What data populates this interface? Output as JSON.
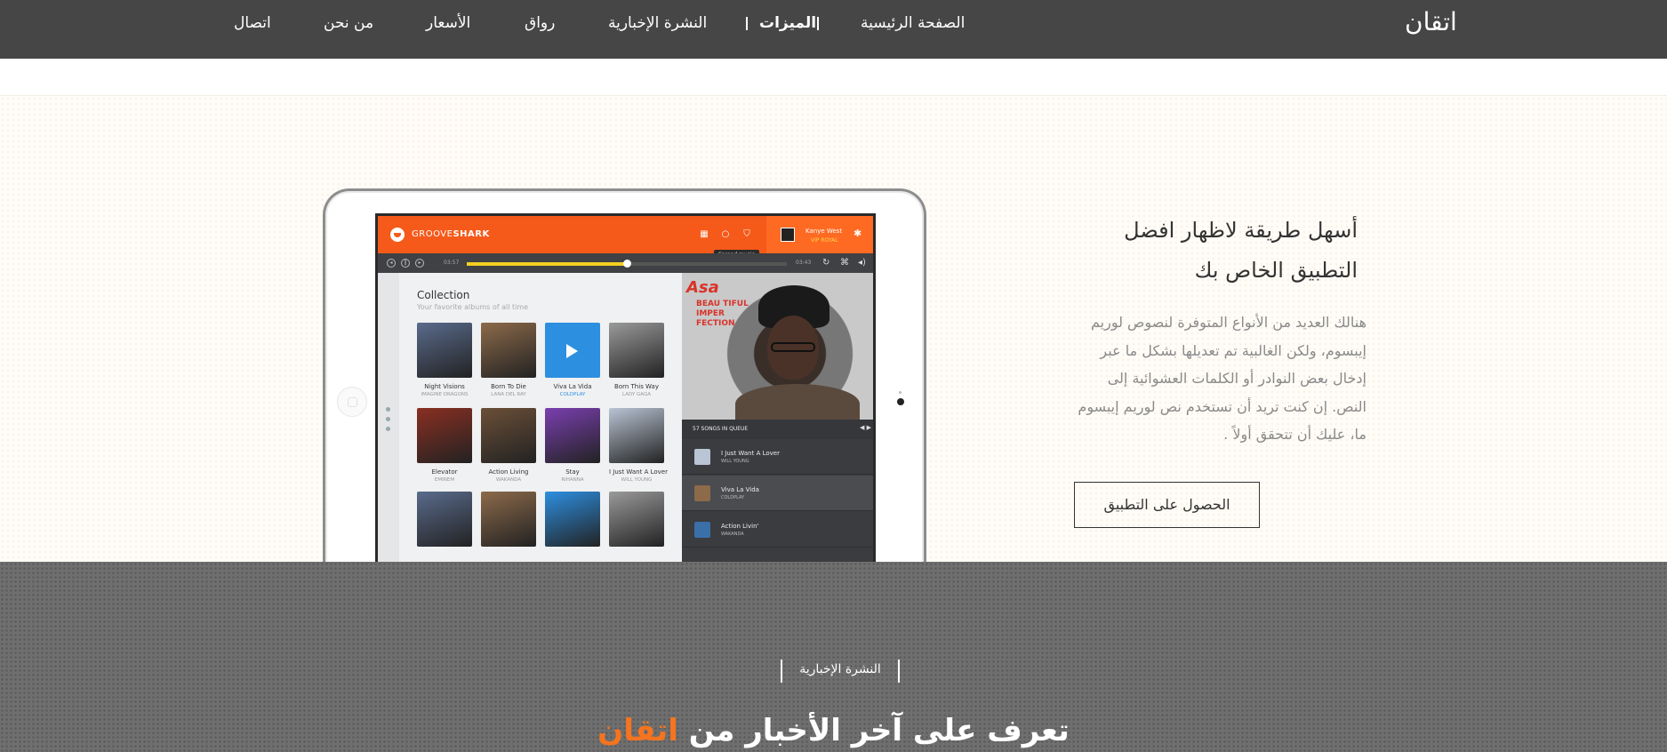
{
  "nav": {
    "brand": "اتقان",
    "links": [
      {
        "label": "الصفحة الرئيسية",
        "active": false
      },
      {
        "label": "الميزات",
        "active": true
      },
      {
        "label": "النشرة الإخبارية",
        "active": false
      },
      {
        "label": "رواق",
        "active": false
      },
      {
        "label": "الأسعار",
        "active": false
      },
      {
        "label": "من نحن",
        "active": false
      },
      {
        "label": "اتصال",
        "active": false
      }
    ]
  },
  "hero": {
    "heading_line1": "أسهل طريقة لاظهار افضل",
    "heading_line2": "التطبيق الخاص بك",
    "paragraph": "هنالك العديد من الأنواع المتوفرة لنصوص لوريم إيبسوم، ولكن الغالبية تم تعديلها بشكل ما عبر إدخال بعض النوادر أو الكلمات العشوائية إلى النص. إن كنت تريد أن تستخدم نص لوريم إيبسوم ما، عليك أن تتحقق أولاً .",
    "cta_label": "الحصول على التطبيق"
  },
  "app_mockup": {
    "brand_light": "GROOVE",
    "brand_bold": "SHARK",
    "user_name": "Kanye West",
    "user_level": "VIP ROYAL",
    "tooltip": "Spread music",
    "time_elapsed": "03:57",
    "time_total": "03:43",
    "progress": 0.5,
    "collection_title": "Collection",
    "collection_subtitle": "Your favorite albums of all time",
    "albums": [
      {
        "title": "Night Visions",
        "artist": "IMAGINE DRAGONS",
        "color": "#5a6b8c",
        "highlight": false
      },
      {
        "title": "Born To Die",
        "artist": "LANA DEL RAY",
        "color": "#8c6a4a",
        "highlight": false
      },
      {
        "title": "Viva La Vida",
        "artist": "COLDPLAY",
        "color": "#2d8fe0",
        "highlight": true
      },
      {
        "title": "Born This Way",
        "artist": "LADY GAGA",
        "color": "#9a9a9a",
        "highlight": false
      },
      {
        "title": "Elevator",
        "artist": "EMINEM",
        "color": "#8a2f22",
        "highlight": false
      },
      {
        "title": "Action Living",
        "artist": "WAKANDA",
        "color": "#6b4f38",
        "highlight": false
      },
      {
        "title": "Stay",
        "artist": "RIHANNA",
        "color": "#7a3fb0",
        "highlight": false
      },
      {
        "title": "I Just Want A Lover",
        "artist": "WILL YOUNG",
        "color": "#b9c4d4",
        "highlight": false
      }
    ],
    "cover_title": "Asa",
    "cover_subtitle": "BEAU TIFUL IMPER FECTION",
    "queue_label": "57 SONGS IN QUEUE",
    "queue": [
      {
        "title": "I Just Want A Lover",
        "artist": "WILL YOUNG",
        "color": "#b9c4d4",
        "active": false
      },
      {
        "title": "Viva La Vida",
        "artist": "COLDPLAY",
        "color": "#8c6a4a",
        "active": true
      },
      {
        "title": "Action Livin'",
        "artist": "WAKANDA",
        "color": "#3a6fa8",
        "active": false
      }
    ]
  },
  "newsletter": {
    "tag": "النشرة الإخبارية",
    "headline_prefix": "تعرف على آخر الأخبار من",
    "headline_brand": "اتقان"
  },
  "colors": {
    "nav_bg": "#464646",
    "accent": "#f5741f",
    "groove_orange": "#f55a1a"
  }
}
